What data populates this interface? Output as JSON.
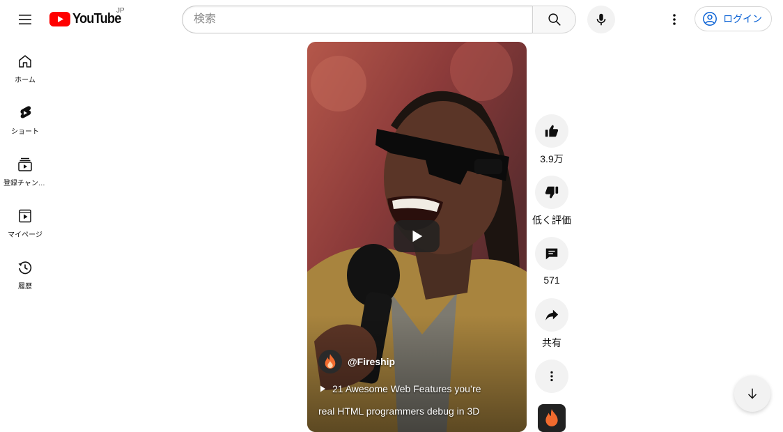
{
  "header": {
    "logo_text": "YouTube",
    "region": "JP",
    "search_placeholder": "検索",
    "login_label": "ログイン"
  },
  "sidebar": {
    "items": [
      {
        "label": "ホーム",
        "icon": "home-icon"
      },
      {
        "label": "ショート",
        "icon": "shorts-icon"
      },
      {
        "label": "登録チャンネル",
        "icon": "subscriptions-icon"
      },
      {
        "label": "マイページ",
        "icon": "library-icon"
      },
      {
        "label": "履歴",
        "icon": "history-icon"
      }
    ]
  },
  "short": {
    "channel": "@Fireship",
    "title_line1": "21 Awesome Web Features you’re",
    "title_line2": "real HTML programmers debug in 3D"
  },
  "actions": {
    "like_count": "3.9万",
    "dislike_label": "低く評価",
    "comment_count": "571",
    "share_label": "共有"
  },
  "colors": {
    "brand_red": "#ff0000",
    "link_blue": "#065fd4",
    "fireship_orange": "#f26b2e"
  }
}
